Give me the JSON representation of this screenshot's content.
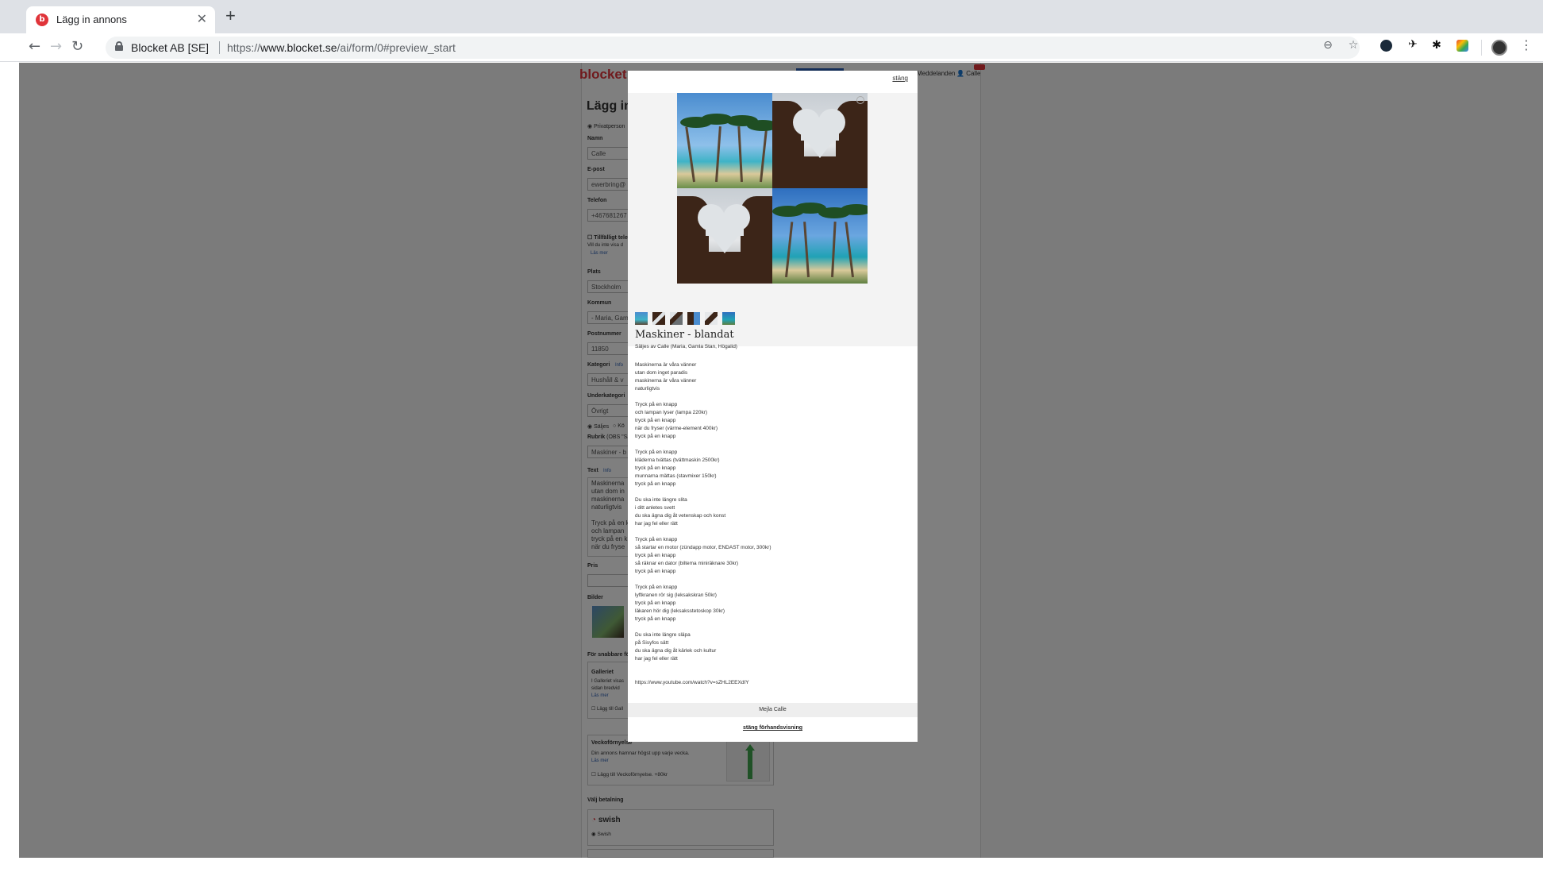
{
  "browser": {
    "tab_title": "Lägg in annons",
    "favicon_letter": "b",
    "tab_close": "✕",
    "new_tab": "+",
    "site_identity": "Blocket AB [SE]",
    "url_prefix": "https://",
    "url_domain": "www.blocket.se",
    "url_path": "/ai/form/0#preview_start",
    "icons": [
      "back-icon",
      "forward-icon",
      "reload-icon",
      "lock-icon",
      "zoom-icon",
      "star-icon",
      "extension-icon",
      "extension-icon",
      "extension-icon",
      "extension-icon",
      "profile-icon",
      "menu-icon"
    ]
  },
  "background_page": {
    "logo": "blocket",
    "nav": {
      "messages": "Meddelanden",
      "user": "Calle"
    },
    "heading": "Lägg in",
    "radio_private": "Privatperson",
    "fields": [
      {
        "label": "Namn",
        "value": "Calle"
      },
      {
        "label": "E-post",
        "value": "ewerbring@"
      },
      {
        "label": "Telefon",
        "value": "+467681267"
      },
      {
        "label": "Plats",
        "value": "Stockholm"
      },
      {
        "label": "Kommun",
        "value": "- Maria, Gam"
      },
      {
        "label": "Postnummer",
        "value": "11850"
      },
      {
        "label": "Kategori",
        "value": "Hushåll & v"
      },
      {
        "label": "Underkategori",
        "value": "Övrigt"
      }
    ],
    "temp_phone": "Tillfälligt tele",
    "temp_phone_desc": "Vill du inte visa d",
    "read_more": "Läs mer",
    "category_info": "Info",
    "sell_option": "Säljes",
    "buy_option": "Kö",
    "rubrik_label": "Rubrik",
    "rubrik_hint": "(OBS \"Sä",
    "rubrik_value": "Maskiner - b",
    "text_label": "Text",
    "text_info": "Info",
    "text_preview": [
      "Maskinerna",
      "utan dom in",
      "maskinerna",
      "naturligtvis",
      "",
      "Tryck på en k",
      "och lampan",
      "tryck på en k",
      "när du fryse"
    ],
    "price_label": "Pris",
    "images_label": "Bilder",
    "quicker_label": "För snabbare fö",
    "gallery_title": "Galleriet",
    "gallery_desc": [
      "I Galleriet visas",
      "sidan bredvid"
    ],
    "gallery_add": "Lägg till Gall",
    "weekly_title": "Veckoförnyelse",
    "weekly_desc": "Din annons hamnar högst upp varje vecka.",
    "weekly_add": "Lägg till Veckoförnyelse. +80kr",
    "payment_label": "Välj betalning",
    "swish_logo": "swish",
    "swish_option": "Swish"
  },
  "modal": {
    "close_top": "stäng",
    "title": "Maskiner - blandat",
    "seller": "Säljes av Calle (Maria, Gamla Stan, Högalid)",
    "body": [
      "Maskinerna är våra vänner",
      "utan dom inget paradis",
      "maskinerna är våra vänner",
      "naturligtvis",
      "",
      "Tryck på en knapp",
      "och lampan lyser (lampa 220kr)",
      "tryck på en knapp",
      "när du fryser (värme-element 400kr)",
      "tryck på en knapp",
      "",
      "Tryck på en knapp",
      "kläderna tvättas (tvättmaskin 2500kr)",
      "tryck på en knapp",
      "munnarna mättas (stavmixer 150kr)",
      "tryck på en knapp",
      "",
      "Du ska inte längre slita",
      "i ditt anletes svett",
      "du ska ägna dig åt vetenskap och konst",
      "har jag fel eller rätt",
      "",
      "Tryck på en knapp",
      "så startar en motor (zündapp motor, ENDAST motor, 300kr)",
      "tryck på en knapp",
      "så räknar en dator (biltema miniräknare 30kr)",
      "tryck på en knapp",
      "",
      "Tryck på en knapp",
      "lyftkranen rör sig (leksakskran 50kr)",
      "tryck på en knapp",
      "läkaren hör dig (leksaksstetoskop 30kr)",
      "tryck på en knapp",
      "",
      "Du ska inte längre släpa",
      "på Sisyfos sätt",
      "du ska ägna dig åt kärlek och kultur",
      "har jag fel eller rätt",
      "",
      "",
      "https://www.youtube.com/watch?v=sZHL2EEXdIY"
    ],
    "mail_button": "Mejla Calle",
    "close_bottom": "stäng förhandsvisning"
  }
}
